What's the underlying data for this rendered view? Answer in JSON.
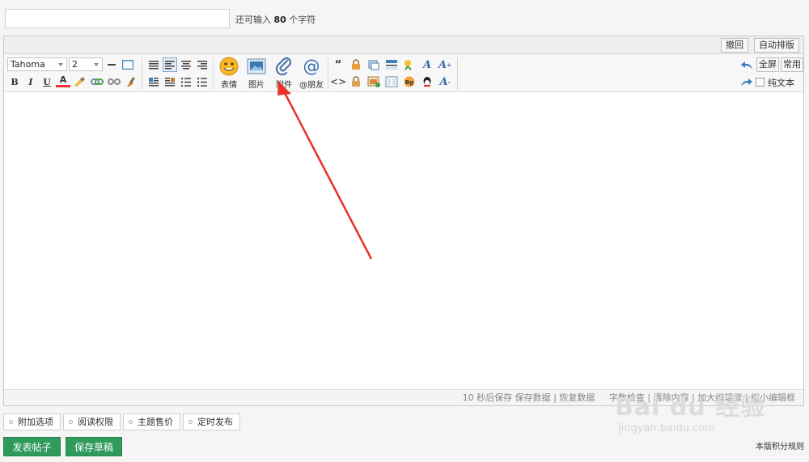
{
  "title_bar": {
    "remain_prefix": "还可输入 ",
    "remain_count": "80",
    "remain_suffix": " 个字符"
  },
  "editor": {
    "top_buttons": {
      "undo": "撤回",
      "auto_layout": "自动排版"
    },
    "font": {
      "family": "Tahoma",
      "size": "2"
    },
    "format_buttons": {
      "bold": "B",
      "italic": "I",
      "underline": "U",
      "font_color": "A"
    },
    "big_buttons": [
      {
        "label": "表情",
        "icon": "smiley-icon"
      },
      {
        "label": "图片",
        "icon": "image-icon"
      },
      {
        "label": "附件",
        "icon": "paperclip-icon"
      },
      {
        "label": "@朋友",
        "icon": "at-icon"
      }
    ],
    "right_buttons": {
      "fullscreen": "全屏",
      "common": "常用",
      "plain_text": "纯文本"
    },
    "status": {
      "autosave": "10 秒后保存 保存数据",
      "restore": "恢复数据",
      "word_check": "字数检查",
      "clear": "清除内容",
      "enlarge": "加大编辑框",
      "shrink": "缩小编辑框"
    }
  },
  "options": [
    "附加选项",
    "阅读权限",
    "主题售价",
    "定时发布"
  ],
  "actions": {
    "post": "发表帖子",
    "save_draft": "保存草稿",
    "rules": "本版积分规则"
  },
  "watermark": {
    "brand": "Bai du 经验",
    "url": "jingyan.baidu.com"
  },
  "annotation": {
    "arrow_color": "#e8312a",
    "accent": "#2f9a5b"
  }
}
